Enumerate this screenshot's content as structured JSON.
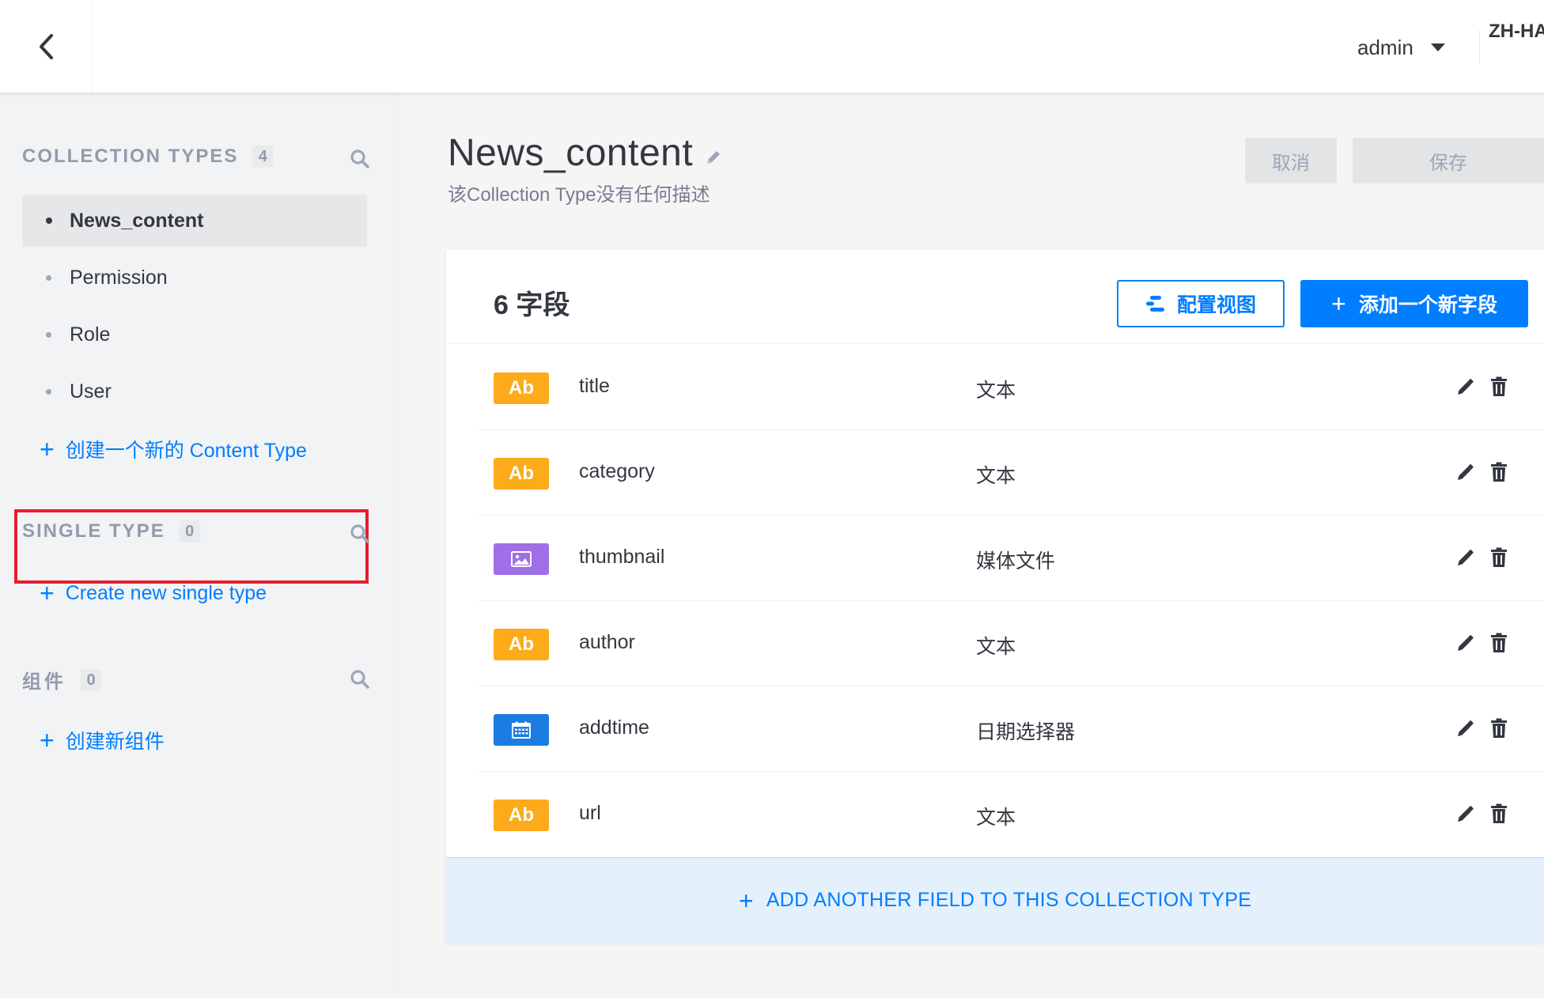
{
  "topbar": {
    "user_name": "admin",
    "language": "ZH-HANS"
  },
  "sidebar": {
    "collection_types": {
      "title": "COLLECTION TYPES",
      "count": "4",
      "items": [
        {
          "label": "News_content",
          "active": true
        },
        {
          "label": "Permission",
          "active": false
        },
        {
          "label": "Role",
          "active": false
        },
        {
          "label": "User",
          "active": false
        }
      ],
      "create_label": "创建一个新的 Content Type"
    },
    "single_type": {
      "title": "SINGLE TYPE",
      "count": "0",
      "create_label": "Create new single type"
    },
    "components": {
      "title": "组件",
      "count": "0",
      "create_label": "创建新组件"
    }
  },
  "header": {
    "title": "News_content",
    "description": "该Collection Type没有任何描述",
    "cancel_label": "取消",
    "save_label": "保存"
  },
  "fields_card": {
    "title": "6 字段",
    "configure_view_label": "配置视图",
    "add_field_label": "添加一个新字段",
    "fields": [
      {
        "name": "title",
        "type": "文本",
        "icon": "text",
        "badge": "Ab"
      },
      {
        "name": "category",
        "type": "文本",
        "icon": "text",
        "badge": "Ab"
      },
      {
        "name": "thumbnail",
        "type": "媒体文件",
        "icon": "media",
        "badge": ""
      },
      {
        "name": "author",
        "type": "文本",
        "icon": "text",
        "badge": "Ab"
      },
      {
        "name": "addtime",
        "type": "日期选择器",
        "icon": "date",
        "badge": ""
      },
      {
        "name": "url",
        "type": "文本",
        "icon": "text",
        "badge": "Ab"
      }
    ],
    "add_another_label": "ADD ANOTHER FIELD TO THIS COLLECTION TYPE"
  },
  "colors": {
    "primary": "#007eff",
    "text_badge": "#fdaa1b",
    "media_badge": "#a06ee6",
    "date_badge": "#1b7de0",
    "highlight": "#e61e2b"
  }
}
